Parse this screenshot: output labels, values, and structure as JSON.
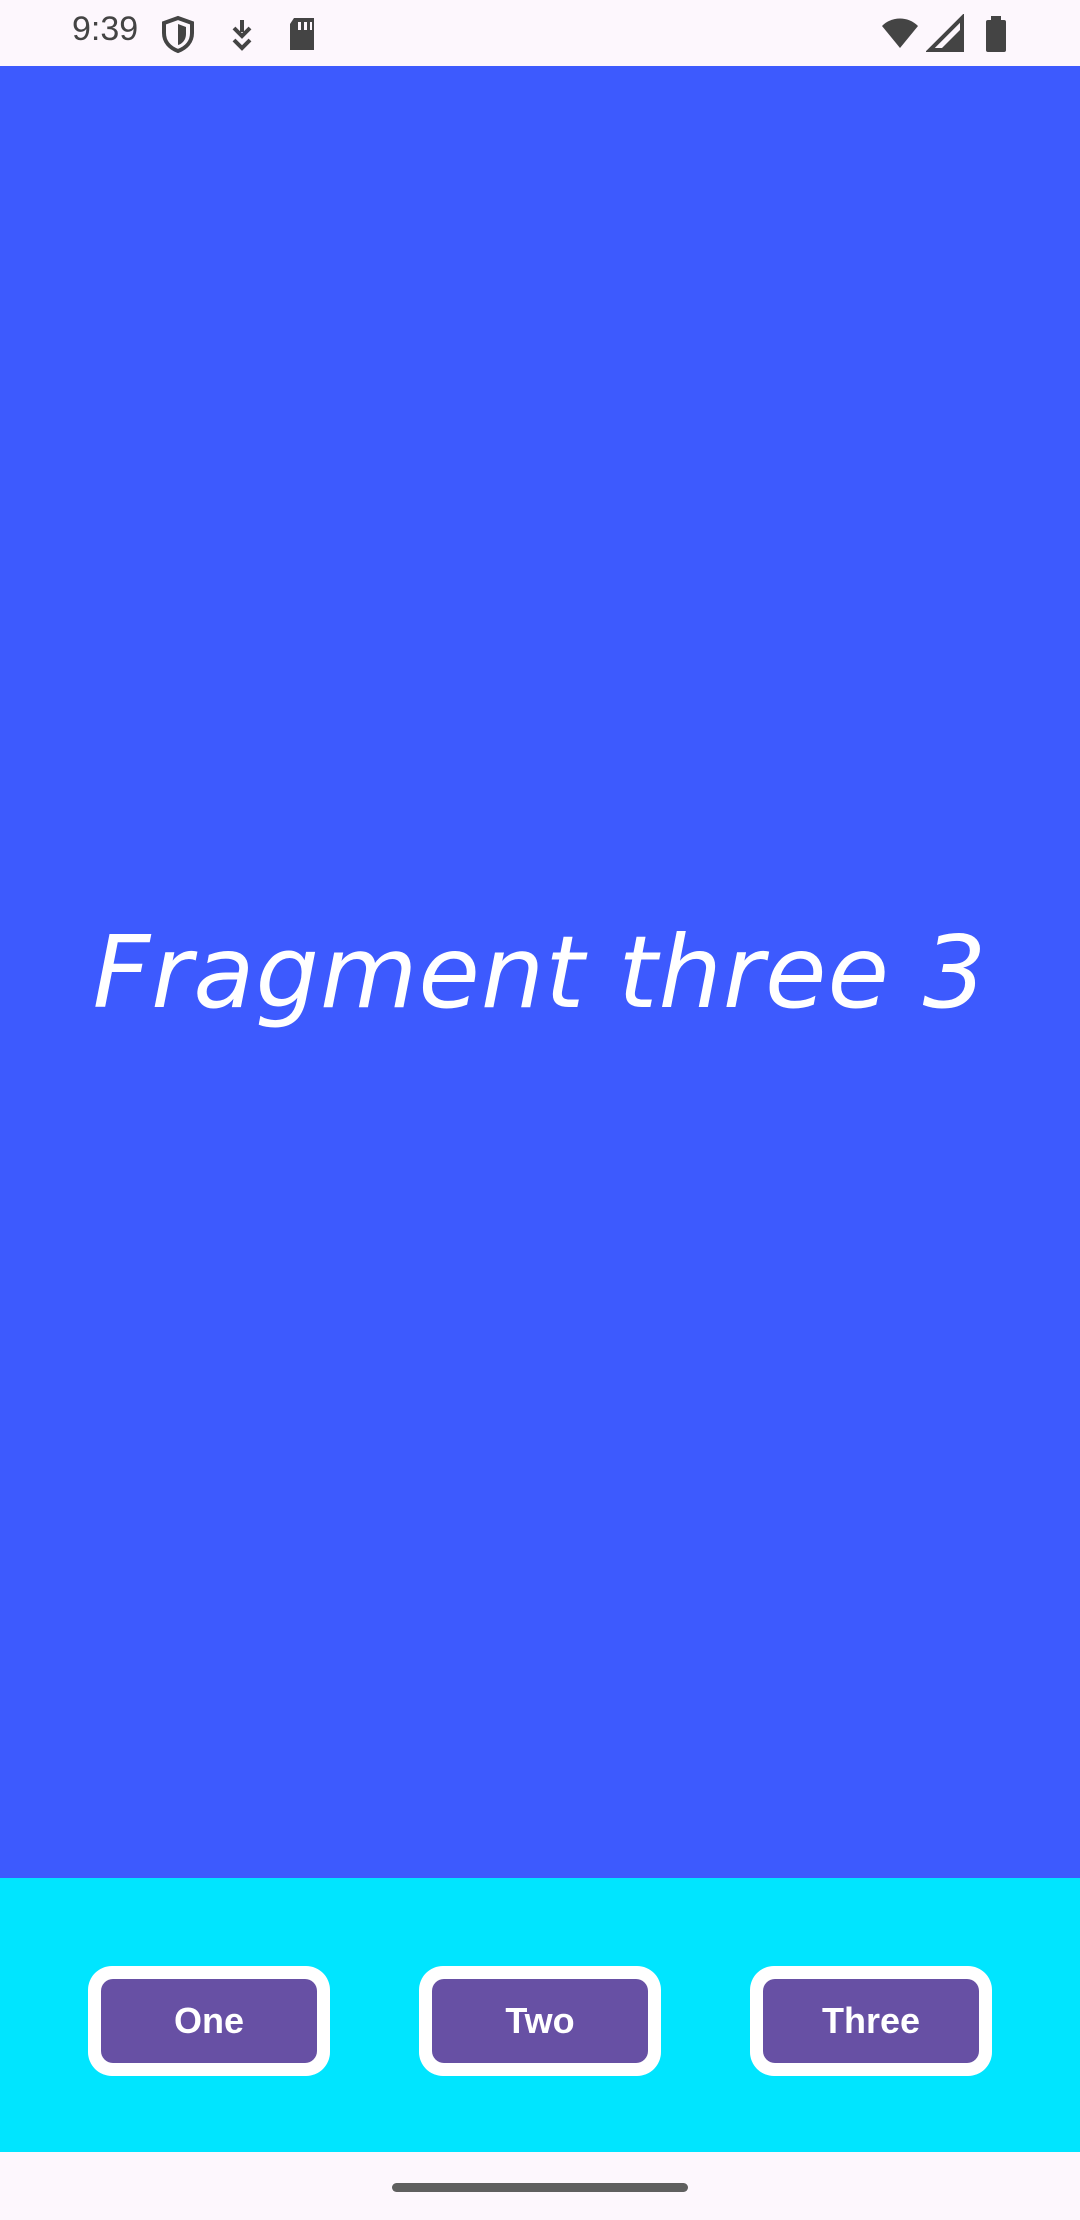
{
  "status_bar": {
    "time": "9:39",
    "icons": [
      "shield-icon",
      "download-icon",
      "sd-card-icon",
      "wifi-icon",
      "signal-icon",
      "battery-icon"
    ]
  },
  "fragment": {
    "text": "Fragment three 3",
    "background_color": "#3d5afe"
  },
  "buttons": {
    "one_label": "One",
    "two_label": "Two",
    "three_label": "Three",
    "bar_color": "#00e5ff",
    "button_color": "#6750a4"
  }
}
